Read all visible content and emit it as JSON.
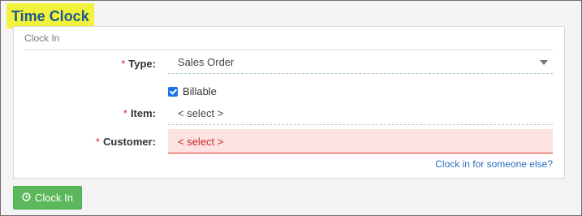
{
  "page": {
    "title": "Time Clock"
  },
  "panel": {
    "heading": "Clock In",
    "required_marker": "*",
    "type": {
      "label": "Type:",
      "value": "Sales Order",
      "icon": "chevron-down-icon"
    },
    "billable": {
      "label": "Billable",
      "checked": true
    },
    "item": {
      "label": "Item:",
      "value": "< select >"
    },
    "customer": {
      "label": "Customer:",
      "value": "< select >"
    },
    "someone_else_link": "Clock in for someone else?"
  },
  "actions": {
    "clock_in_label": "Clock In",
    "icon": "clock-icon"
  },
  "colors": {
    "title_highlight": "#f2f23c",
    "title_text": "#1d5a8c",
    "required": "#d9302d",
    "error_bg": "#fde2e2",
    "link": "#2a6ebb",
    "button": "#5cb85c"
  }
}
